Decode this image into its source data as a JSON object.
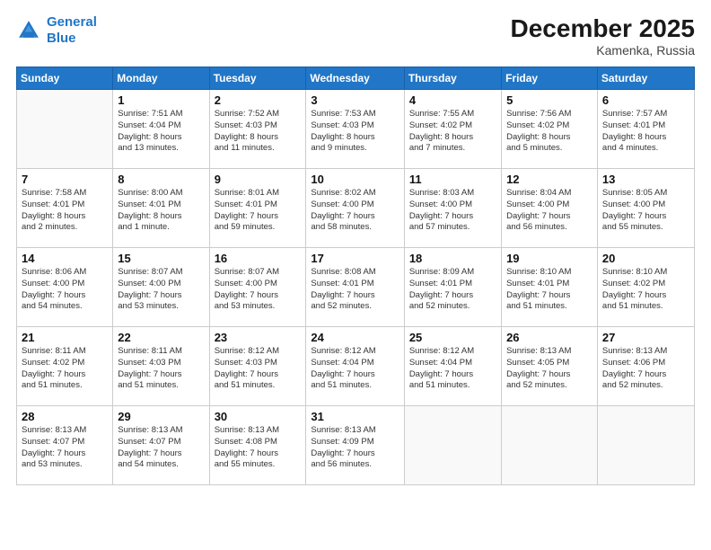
{
  "logo": {
    "line1": "General",
    "line2": "Blue"
  },
  "title": "December 2025",
  "subtitle": "Kamenka, Russia",
  "days_header": [
    "Sunday",
    "Monday",
    "Tuesday",
    "Wednesday",
    "Thursday",
    "Friday",
    "Saturday"
  ],
  "weeks": [
    [
      {
        "day": "",
        "info": ""
      },
      {
        "day": "1",
        "info": "Sunrise: 7:51 AM\nSunset: 4:04 PM\nDaylight: 8 hours\nand 13 minutes."
      },
      {
        "day": "2",
        "info": "Sunrise: 7:52 AM\nSunset: 4:03 PM\nDaylight: 8 hours\nand 11 minutes."
      },
      {
        "day": "3",
        "info": "Sunrise: 7:53 AM\nSunset: 4:03 PM\nDaylight: 8 hours\nand 9 minutes."
      },
      {
        "day": "4",
        "info": "Sunrise: 7:55 AM\nSunset: 4:02 PM\nDaylight: 8 hours\nand 7 minutes."
      },
      {
        "day": "5",
        "info": "Sunrise: 7:56 AM\nSunset: 4:02 PM\nDaylight: 8 hours\nand 5 minutes."
      },
      {
        "day": "6",
        "info": "Sunrise: 7:57 AM\nSunset: 4:01 PM\nDaylight: 8 hours\nand 4 minutes."
      }
    ],
    [
      {
        "day": "7",
        "info": "Sunrise: 7:58 AM\nSunset: 4:01 PM\nDaylight: 8 hours\nand 2 minutes."
      },
      {
        "day": "8",
        "info": "Sunrise: 8:00 AM\nSunset: 4:01 PM\nDaylight: 8 hours\nand 1 minute."
      },
      {
        "day": "9",
        "info": "Sunrise: 8:01 AM\nSunset: 4:01 PM\nDaylight: 7 hours\nand 59 minutes."
      },
      {
        "day": "10",
        "info": "Sunrise: 8:02 AM\nSunset: 4:00 PM\nDaylight: 7 hours\nand 58 minutes."
      },
      {
        "day": "11",
        "info": "Sunrise: 8:03 AM\nSunset: 4:00 PM\nDaylight: 7 hours\nand 57 minutes."
      },
      {
        "day": "12",
        "info": "Sunrise: 8:04 AM\nSunset: 4:00 PM\nDaylight: 7 hours\nand 56 minutes."
      },
      {
        "day": "13",
        "info": "Sunrise: 8:05 AM\nSunset: 4:00 PM\nDaylight: 7 hours\nand 55 minutes."
      }
    ],
    [
      {
        "day": "14",
        "info": "Sunrise: 8:06 AM\nSunset: 4:00 PM\nDaylight: 7 hours\nand 54 minutes."
      },
      {
        "day": "15",
        "info": "Sunrise: 8:07 AM\nSunset: 4:00 PM\nDaylight: 7 hours\nand 53 minutes."
      },
      {
        "day": "16",
        "info": "Sunrise: 8:07 AM\nSunset: 4:00 PM\nDaylight: 7 hours\nand 53 minutes."
      },
      {
        "day": "17",
        "info": "Sunrise: 8:08 AM\nSunset: 4:01 PM\nDaylight: 7 hours\nand 52 minutes."
      },
      {
        "day": "18",
        "info": "Sunrise: 8:09 AM\nSunset: 4:01 PM\nDaylight: 7 hours\nand 52 minutes."
      },
      {
        "day": "19",
        "info": "Sunrise: 8:10 AM\nSunset: 4:01 PM\nDaylight: 7 hours\nand 51 minutes."
      },
      {
        "day": "20",
        "info": "Sunrise: 8:10 AM\nSunset: 4:02 PM\nDaylight: 7 hours\nand 51 minutes."
      }
    ],
    [
      {
        "day": "21",
        "info": "Sunrise: 8:11 AM\nSunset: 4:02 PM\nDaylight: 7 hours\nand 51 minutes."
      },
      {
        "day": "22",
        "info": "Sunrise: 8:11 AM\nSunset: 4:03 PM\nDaylight: 7 hours\nand 51 minutes."
      },
      {
        "day": "23",
        "info": "Sunrise: 8:12 AM\nSunset: 4:03 PM\nDaylight: 7 hours\nand 51 minutes."
      },
      {
        "day": "24",
        "info": "Sunrise: 8:12 AM\nSunset: 4:04 PM\nDaylight: 7 hours\nand 51 minutes."
      },
      {
        "day": "25",
        "info": "Sunrise: 8:12 AM\nSunset: 4:04 PM\nDaylight: 7 hours\nand 51 minutes."
      },
      {
        "day": "26",
        "info": "Sunrise: 8:13 AM\nSunset: 4:05 PM\nDaylight: 7 hours\nand 52 minutes."
      },
      {
        "day": "27",
        "info": "Sunrise: 8:13 AM\nSunset: 4:06 PM\nDaylight: 7 hours\nand 52 minutes."
      }
    ],
    [
      {
        "day": "28",
        "info": "Sunrise: 8:13 AM\nSunset: 4:07 PM\nDaylight: 7 hours\nand 53 minutes."
      },
      {
        "day": "29",
        "info": "Sunrise: 8:13 AM\nSunset: 4:07 PM\nDaylight: 7 hours\nand 54 minutes."
      },
      {
        "day": "30",
        "info": "Sunrise: 8:13 AM\nSunset: 4:08 PM\nDaylight: 7 hours\nand 55 minutes."
      },
      {
        "day": "31",
        "info": "Sunrise: 8:13 AM\nSunset: 4:09 PM\nDaylight: 7 hours\nand 56 minutes."
      },
      {
        "day": "",
        "info": ""
      },
      {
        "day": "",
        "info": ""
      },
      {
        "day": "",
        "info": ""
      }
    ]
  ]
}
